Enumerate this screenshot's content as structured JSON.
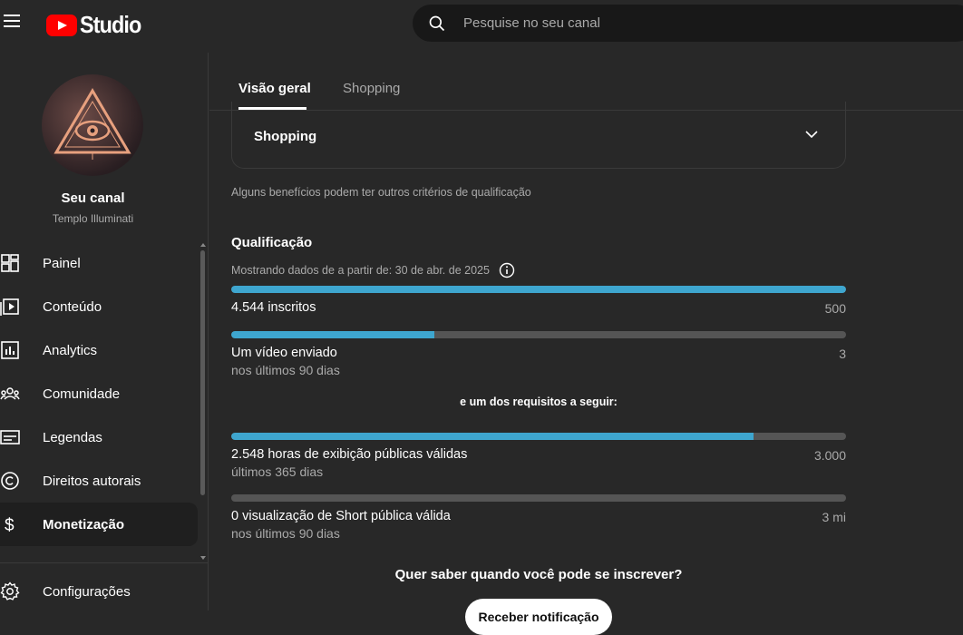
{
  "header": {
    "logo_text": "Studio",
    "search_placeholder": "Pesquise no seu canal"
  },
  "sidebar": {
    "channel_title": "Seu canal",
    "channel_name": "Templo Illuminati",
    "items": [
      {
        "label": "Painel",
        "icon": "dashboard-icon"
      },
      {
        "label": "Conteúdo",
        "icon": "content-icon"
      },
      {
        "label": "Analytics",
        "icon": "analytics-icon"
      },
      {
        "label": "Comunidade",
        "icon": "community-icon"
      },
      {
        "label": "Legendas",
        "icon": "subtitles-icon"
      },
      {
        "label": "Direitos autorais",
        "icon": "copyright-icon"
      },
      {
        "label": "Monetização",
        "icon": "dollar-icon",
        "active": true
      }
    ],
    "settings_label": "Configurações"
  },
  "tabs": [
    {
      "label": "Visão geral",
      "active": true
    },
    {
      "label": "Shopping",
      "active": false
    }
  ],
  "main": {
    "shopping_card_title": "Shopping",
    "eligibility_note": "Alguns benefícios podem ter outros critérios de qualificação",
    "qualification_title": "Qualificação",
    "data_since": "Mostrando dados de a partir de: 30 de abr. de 2025",
    "requirements": [
      {
        "label": "4.544 inscritos",
        "sub": "",
        "target": "500",
        "progress": 1.0
      },
      {
        "label": "Um vídeo enviado",
        "sub": "nos últimos 90 dias",
        "target": "3",
        "progress": 0.33
      }
    ],
    "and_one_of": "e um dos requisitos a seguir:",
    "alternatives": [
      {
        "label": "2.548 horas de exibição públicas válidas",
        "sub": "últimos 365 dias",
        "target": "3.000",
        "progress": 0.849
      },
      {
        "label": "0 visualização de Short pública válida",
        "sub": "nos últimos 90 dias",
        "target": "3 mi",
        "progress": 0.0
      }
    ],
    "question": "Quer saber quando você pode se inscrever?",
    "notify_button": "Receber notificação"
  },
  "colors": {
    "accent": "#3ea6cf",
    "brand_red": "#ff0000",
    "background": "#282828"
  }
}
